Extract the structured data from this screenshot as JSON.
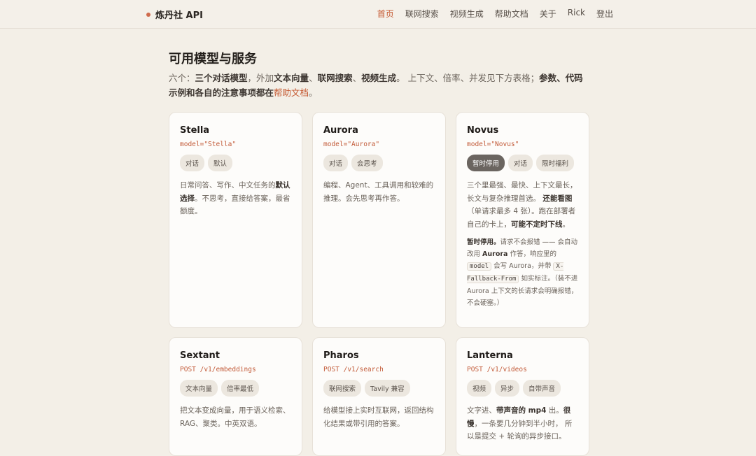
{
  "header": {
    "brand": "炼丹社 API",
    "nav": [
      "首页",
      "联网搜索",
      "视频生成",
      "帮助文档",
      "关于",
      "Rick",
      "登出"
    ]
  },
  "page": {
    "title": "可用模型与服务",
    "intro": {
      "p1": "六个：",
      "b1": "三个对话模型",
      "p2": "，外加",
      "b2": "文本向量",
      "p3": "、",
      "b3": "联网搜索",
      "p4": "、",
      "b4": "视频生成",
      "p5": "。 上下文、倍率、并发见下方表格；",
      "b5": "参数、代码示例和各自的注意事项都在",
      "link": "帮助文档",
      "end": "。"
    }
  },
  "cards": [
    {
      "name": "Stella",
      "code": "model=\"Stella\"",
      "tags": [
        "对话",
        "默认"
      ],
      "desc": {
        "t1": "日常问答、写作、中文任务的",
        "b1": "默认选择",
        "t2": "。不思考，直接给答案，最省额度。"
      }
    },
    {
      "name": "Aurora",
      "code": "model=\"Aurora\"",
      "tags": [
        "对话",
        "会思考"
      ],
      "desc": {
        "t1": "编程、Agent、工具调用和较难的推理。会先思考再作答。"
      }
    },
    {
      "name": "Novus",
      "code": "model=\"Novus\"",
      "tags": [
        "暂时停用",
        "对话",
        "限时福利"
      ],
      "desc": {
        "t1": "三个里最强、最快、上下文最长，长文与复杂推理首选。 ",
        "b1": "还能看图",
        "t2": "（单请求最多 4 张）。跑在部署者自己的卡上，",
        "b2": "可能不定时下线",
        "t3": "。"
      },
      "note": {
        "b1": "暂时停用。",
        "t1": "请求不会报错 —— 会自动改用 ",
        "b2": "Aurora",
        "t2": " 作答，响应里的 ",
        "code1": "model",
        "t3": " 会写 Aurora，并带 ",
        "code2": "X-Fallback-From",
        "t4": " 如实标注。（装不进 Aurora 上下文的长请求会明确报错，不会硬塞。）"
      }
    },
    {
      "name": "Sextant",
      "code": "POST /v1/embeddings",
      "tags": [
        "文本向量",
        "倍率最低"
      ],
      "desc": {
        "t1": "把文本变成向量，用于语义检索、RAG、聚类。中英双语。"
      }
    },
    {
      "name": "Pharos",
      "code": "POST /v1/search",
      "tags": [
        "联网搜索",
        "Tavily 兼容"
      ],
      "desc": {
        "t1": "给模型接上实时互联网，返回结构化结果或带引用的答案。"
      }
    },
    {
      "name": "Lanterna",
      "code": "POST /v1/videos",
      "tags": [
        "视频",
        "异步",
        "自带声音"
      ],
      "desc": {
        "t1": "文字进、",
        "b1": "带声音的 mp4",
        "t2": " 出。",
        "b2": "很慢",
        "t3": "，一条要几分钟到半小时， 所以是提交 + 轮询的异步接口。"
      }
    }
  ]
}
